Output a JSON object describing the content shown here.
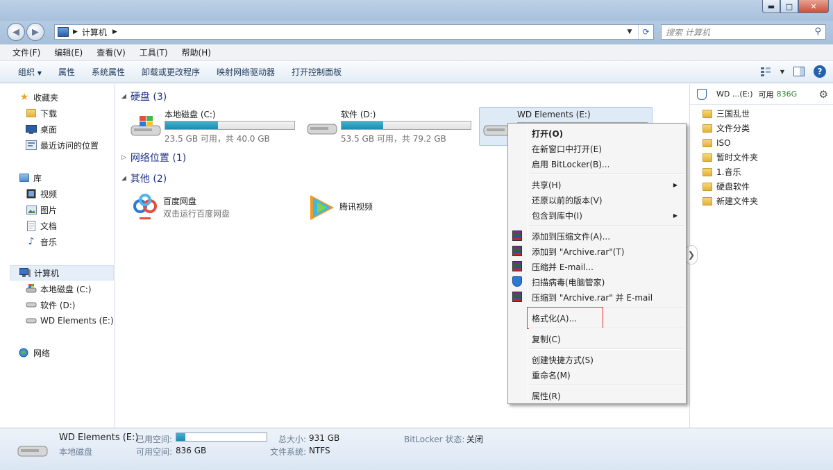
{
  "window": {
    "controls": {
      "minimize": "▬",
      "maximize": "□",
      "close": "✕"
    }
  },
  "nav": {
    "address_path": "计算机",
    "search_placeholder": "搜索 计算机"
  },
  "menubar": [
    "文件(F)",
    "编辑(E)",
    "查看(V)",
    "工具(T)",
    "帮助(H)"
  ],
  "toolbar": {
    "organize": "组织",
    "commands": [
      "属性",
      "系统属性",
      "卸载或更改程序",
      "映射网络驱动器",
      "打开控制面板"
    ]
  },
  "sidebar": {
    "favorites": {
      "label": "收藏夹",
      "items": [
        "下载",
        "桌面",
        "最近访问的位置"
      ]
    },
    "libraries": {
      "label": "库",
      "items": [
        "视频",
        "图片",
        "文档",
        "音乐"
      ]
    },
    "computer": {
      "label": "计算机",
      "items": [
        "本地磁盘 (C:)",
        "软件 (D:)",
        "WD Elements (E:)"
      ]
    },
    "network": {
      "label": "网络"
    }
  },
  "main": {
    "groups": {
      "hard_disks": "硬盘 (3)",
      "network": "网络位置 (1)",
      "other": "其他 (2)"
    },
    "drives": [
      {
        "name": "本地磁盘 (C:)",
        "free_text": "23.5 GB 可用，共 40.0 GB",
        "used_fraction": 0.41
      },
      {
        "name": "软件 (D:)",
        "free_text": "53.5 GB 可用，共 79.2 GB",
        "used_fraction": 0.32
      },
      {
        "name": "WD Elements (E:)",
        "used_fraction": 0.1
      }
    ],
    "apps": [
      {
        "name": "百度网盘",
        "desc": "双击运行百度网盘"
      },
      {
        "name": "腾讯视频",
        "desc": ""
      }
    ]
  },
  "right_pane": {
    "header_name": "WD ...(E:)",
    "header_free_label": "可用",
    "header_free_value": "836G",
    "folders": [
      "三国乱世",
      "文件分类",
      "ISO",
      "暂时文件夹",
      "1.音乐",
      "硬盘软件",
      "新建文件夹"
    ]
  },
  "context_menu": {
    "items": {
      "open": "打开(O)",
      "open_new_window": "在新窗口中打开(E)",
      "bitlocker": "启用 BitLocker(B)...",
      "share": "共享(H)",
      "restore": "还原以前的版本(V)",
      "include_library": "包含到库中(I)",
      "add_archive": "添加到压缩文件(A)...",
      "add_archive_rar": "添加到 \"Archive.rar\"(T)",
      "compress_email": "压缩并 E-mail...",
      "scan_virus": "扫描病毒(电脑管家)",
      "compress_rar_email": "压缩到 \"Archive.rar\" 并 E-mail",
      "format": "格式化(A)...",
      "copy": "复制(C)",
      "shortcut": "创建快捷方式(S)",
      "rename": "重命名(M)",
      "properties": "属性(R)"
    }
  },
  "status": {
    "drive_name": "WD Elements (E:)",
    "drive_type": "本地磁盘",
    "used_label": "已用空间:",
    "used_fraction": 0.1,
    "free_label": "可用空间:",
    "free_value": "836 GB",
    "total_label": "总大小:",
    "total_value": "931 GB",
    "fs_label": "文件系统:",
    "fs_value": "NTFS",
    "bitlocker_label": "BitLocker 状态:",
    "bitlocker_value": "关闭"
  },
  "colors": {
    "accent": "#1e3287",
    "bar_fill": "#1f8ab0",
    "highlight_box": "#e02c2c",
    "free_green": "#2a8a2a"
  }
}
